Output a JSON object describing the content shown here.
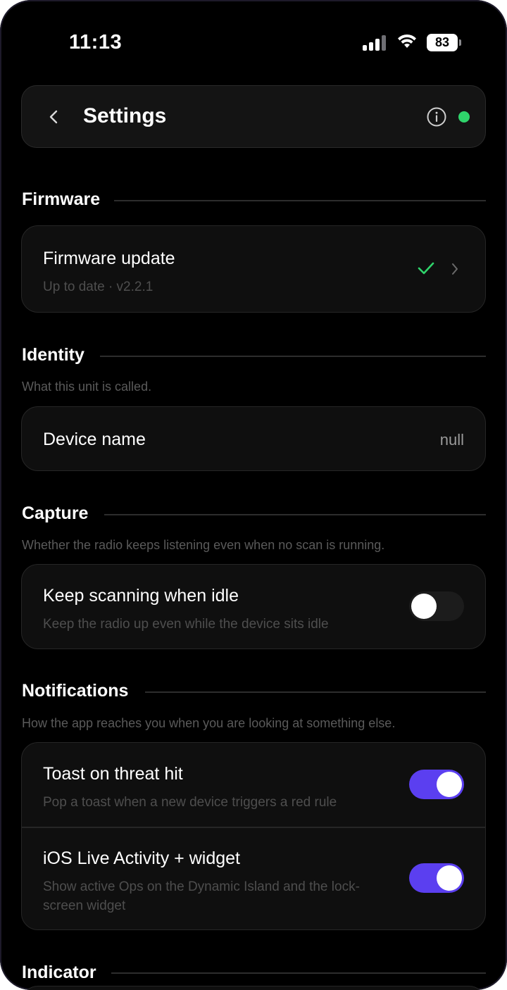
{
  "status_bar": {
    "time": "11:13",
    "battery": "83"
  },
  "header": {
    "title": "Settings"
  },
  "colors": {
    "accent": "#5b3ff0",
    "online": "#2fd46b",
    "check": "#2fd46b"
  },
  "sections": {
    "firmware": {
      "title": "Firmware",
      "row": {
        "title": "Firmware update",
        "subtitle": "Up to date · v2.2.1",
        "status_icon": "check-icon"
      }
    },
    "identity": {
      "title": "Identity",
      "description": "What this unit is called.",
      "row": {
        "title": "Device name",
        "value": "null"
      }
    },
    "capture": {
      "title": "Capture",
      "description": "Whether the radio keeps listening even when no scan is running.",
      "row": {
        "title": "Keep scanning when idle",
        "subtitle": "Keep the radio up even while the device sits idle",
        "enabled": false
      }
    },
    "notifications": {
      "title": "Notifications",
      "description": "How the app reaches you when you are looking at something else.",
      "rows": [
        {
          "title": "Toast on threat hit",
          "subtitle": "Pop a toast when a new device triggers a red rule",
          "enabled": true
        },
        {
          "title": "iOS Live Activity + widget",
          "subtitle_line1": "Show active Ops on the Dynamic Island and the lock-",
          "subtitle_line2": "screen widget",
          "enabled": true
        }
      ]
    },
    "indicator": {
      "title": "Indicator"
    }
  }
}
